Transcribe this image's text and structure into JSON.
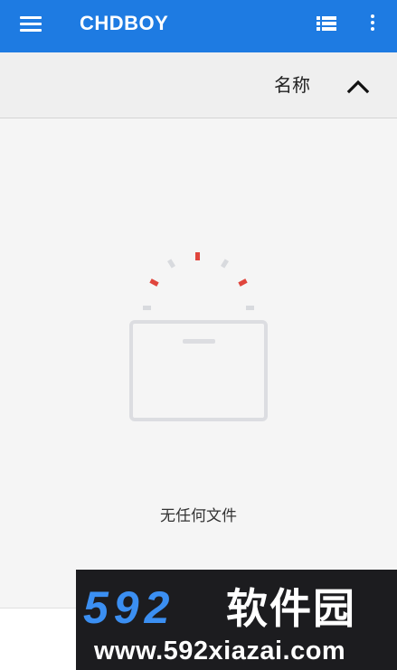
{
  "appbar": {
    "title": "CHDBOY",
    "menu_icon": "hamburger-menu-icon",
    "view_icon": "list-view-icon",
    "more_icon": "more-vert-icon",
    "background_color": "#1e7be2"
  },
  "sortbar": {
    "label": "名称",
    "direction_icon": "chevron-up-icon"
  },
  "empty_state": {
    "message": "无任何文件",
    "icon": "empty-folder-icon",
    "accent_color": "#e0463d"
  },
  "watermark": {
    "brand_number": "592",
    "brand_name": "软件园",
    "url": "www.592xiazai.com"
  }
}
